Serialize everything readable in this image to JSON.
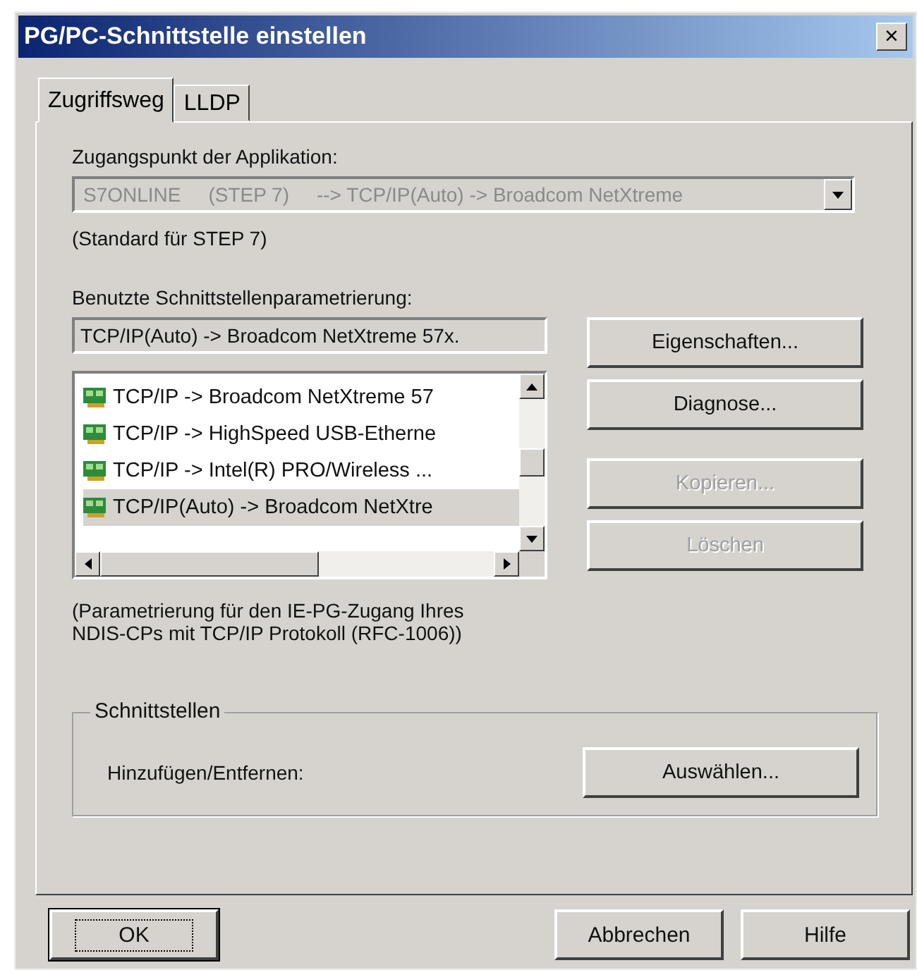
{
  "window": {
    "title": "PG/PC-Schnittstelle einstellen",
    "close": "×"
  },
  "tabs": [
    {
      "label": "Zugriffsweg",
      "selected": true
    },
    {
      "label": "LLDP",
      "selected": false
    }
  ],
  "access_point": {
    "label": "Zugangspunkt der Applikation:",
    "value": "S7ONLINE     (STEP 7)     --> TCP/IP(Auto) -> Broadcom NetXtreme",
    "disabled": true,
    "note": "(Standard für STEP 7)"
  },
  "parametrization": {
    "label": "Benutzte Schnittstellenparametrierung:",
    "value": "TCP/IP(Auto) -> Broadcom NetXtreme 57x.",
    "items": [
      {
        "label": "TCP/IP -> Broadcom NetXtreme 57",
        "selected": false
      },
      {
        "label": "TCP/IP -> HighSpeed USB-Etherne",
        "selected": false
      },
      {
        "label": "TCP/IP -> Intel(R) PRO/Wireless ...",
        "selected": false
      },
      {
        "label": "TCP/IP(Auto) -> Broadcom NetXtre",
        "selected": true
      }
    ],
    "description": "(Parametrierung für den IE-PG-Zugang Ihres NDIS-CPs mit TCP/IP Protokoll (RFC-1006))"
  },
  "side_buttons": [
    {
      "label": "Eigenschaften...",
      "disabled": false
    },
    {
      "label": "Diagnose...",
      "disabled": false
    },
    {
      "label": "Kopieren...",
      "disabled": true
    },
    {
      "label": "Löschen",
      "disabled": true
    }
  ],
  "interfaces": {
    "title": "Schnittstellen",
    "label": "Hinzufügen/Entfernen:",
    "button": "Auswählen..."
  },
  "buttons": [
    {
      "label": "OK",
      "kind": "default"
    },
    {
      "label": "Abbrechen",
      "kind": "normal"
    },
    {
      "label": "Hilfe",
      "kind": "normal"
    }
  ]
}
